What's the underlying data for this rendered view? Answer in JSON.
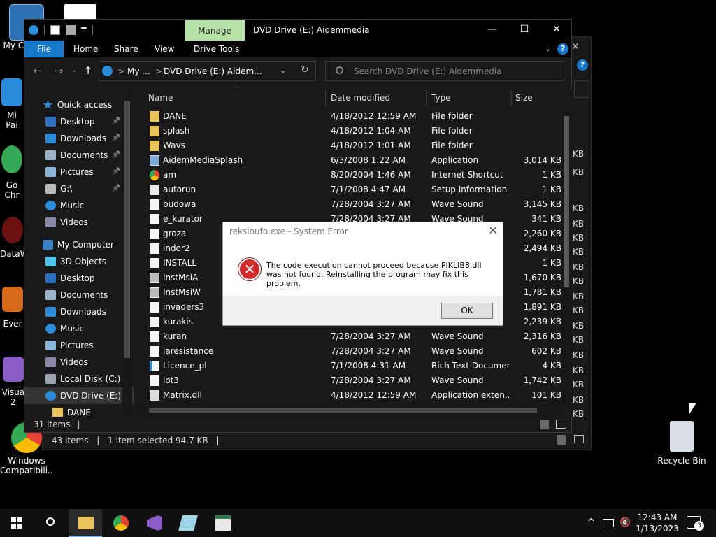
{
  "desktop": {
    "icons": [
      {
        "label": "My Co",
        "icon": "computer-icon"
      },
      {
        "label": "Mi\nPai",
        "icon": "paint-icon"
      },
      {
        "label": "Go\nChr",
        "icon": "chrome-icon"
      },
      {
        "label": "DataW",
        "icon": "datawiz-icon"
      },
      {
        "label": "Ever",
        "icon": "app-icon"
      },
      {
        "label": "Visua\n2",
        "icon": "visual-studio-icon"
      },
      {
        "label": "Windows\nCompatibili...",
        "icon": "chrome-icon"
      },
      {
        "label": "Recycle Bin",
        "icon": "recycle-bin-icon"
      }
    ]
  },
  "back_window": {
    "status_items": "43 items",
    "status_selected": "1 item selected  94.7 KB",
    "size_fragment": "KB"
  },
  "window": {
    "title": "DVD Drive (E:) Aidemmedia",
    "manage_tab": "Manage",
    "ribbon_tabs": [
      "File",
      "Home",
      "Share",
      "View",
      "Drive Tools"
    ],
    "help": "?",
    "address": {
      "part1": "My ...",
      "sep": ">",
      "part2": "DVD Drive (E:) Aidem..."
    },
    "search_placeholder": "Search DVD Drive (E:) Aidemmedia",
    "controls": {
      "minimize": "—",
      "maximize": "☐",
      "close": "✕"
    }
  },
  "navpane": [
    {
      "label": "Quick access",
      "icon": "star-icon",
      "pin": false,
      "indent": 0
    },
    {
      "label": "Desktop",
      "icon": "desktop-icon",
      "pin": true,
      "indent": 1
    },
    {
      "label": "Downloads",
      "icon": "downloads-icon",
      "pin": true,
      "indent": 1
    },
    {
      "label": "Documents",
      "icon": "documents-icon",
      "pin": true,
      "indent": 1
    },
    {
      "label": "Pictures",
      "icon": "pictures-icon",
      "pin": true,
      "indent": 1
    },
    {
      "label": "G:\\",
      "icon": "drive-icon",
      "pin": true,
      "indent": 1
    },
    {
      "label": "Music",
      "icon": "music-icon",
      "pin": false,
      "indent": 1
    },
    {
      "label": "Videos",
      "icon": "videos-icon",
      "pin": false,
      "indent": 1
    },
    {
      "label": "My Computer",
      "icon": "computer-icon",
      "pin": false,
      "indent": 0
    },
    {
      "label": "3D Objects",
      "icon": "3d-objects-icon",
      "pin": false,
      "indent": 1
    },
    {
      "label": "Desktop",
      "icon": "desktop-icon",
      "pin": false,
      "indent": 1
    },
    {
      "label": "Documents",
      "icon": "documents-icon",
      "pin": false,
      "indent": 1
    },
    {
      "label": "Downloads",
      "icon": "downloads-icon",
      "pin": false,
      "indent": 1
    },
    {
      "label": "Music",
      "icon": "music-icon",
      "pin": false,
      "indent": 1
    },
    {
      "label": "Pictures",
      "icon": "pictures-icon",
      "pin": false,
      "indent": 1
    },
    {
      "label": "Videos",
      "icon": "videos-icon",
      "pin": false,
      "indent": 1
    },
    {
      "label": "Local Disk (C:)",
      "icon": "local-disk-icon",
      "pin": false,
      "indent": 1
    },
    {
      "label": "DVD Drive (E:) Ai",
      "icon": "dvd-drive-icon",
      "pin": false,
      "indent": 1,
      "selected": true
    },
    {
      "label": "DANE",
      "icon": "folder-icon",
      "pin": false,
      "indent": 2
    }
  ],
  "columns": [
    "Name",
    "Date modified",
    "Type",
    "Size"
  ],
  "files": [
    {
      "name": "DANE",
      "date": "4/18/2012 12:59 AM",
      "type": "File folder",
      "size": "",
      "icon": "folder-icon"
    },
    {
      "name": "splash",
      "date": "4/18/2012 1:04 AM",
      "type": "File folder",
      "size": "",
      "icon": "folder-icon"
    },
    {
      "name": "Wavs",
      "date": "4/18/2012 1:01 AM",
      "type": "File folder",
      "size": "",
      "icon": "folder-icon"
    },
    {
      "name": "AidemMediaSplash",
      "date": "6/3/2008 1:22 AM",
      "type": "Application",
      "size": "3,014 KB",
      "icon": "application-icon"
    },
    {
      "name": "am",
      "date": "8/20/2004 1:46 AM",
      "type": "Internet Shortcut",
      "size": "1 KB",
      "icon": "chrome-icon"
    },
    {
      "name": "autorun",
      "date": "7/1/2008 4:47 AM",
      "type": "Setup Information",
      "size": "1 KB",
      "icon": "setup-icon"
    },
    {
      "name": "budowa",
      "date": "7/28/2004 3:27 AM",
      "type": "Wave Sound",
      "size": "3,145 KB",
      "icon": "wave-icon"
    },
    {
      "name": "e_kurator",
      "date": "7/28/2004 3:27 AM",
      "type": "Wave Sound",
      "size": "341 KB",
      "icon": "wave-icon"
    },
    {
      "name": "groza",
      "date": "",
      "type": "",
      "size": "2,260 KB",
      "icon": "wave-icon"
    },
    {
      "name": "indor2",
      "date": "",
      "type": "",
      "size": "2,494 KB",
      "icon": "wave-icon"
    },
    {
      "name": "INSTALL",
      "date": "",
      "type": "",
      "size": "1 KB",
      "icon": "text-file-icon"
    },
    {
      "name": "InstMsiA",
      "date": "",
      "type": "",
      "size": "1,670 KB",
      "icon": "installer-icon"
    },
    {
      "name": "InstMsiW",
      "date": "",
      "type": "",
      "size": "1,781 KB",
      "icon": "installer-icon"
    },
    {
      "name": "invaders3",
      "date": "",
      "type": "",
      "size": "1,891 KB",
      "icon": "wave-icon"
    },
    {
      "name": "kurakis",
      "date": "",
      "type": "",
      "size": "2,239 KB",
      "icon": "wave-icon"
    },
    {
      "name": "kuran",
      "date": "7/28/2004 3:27 AM",
      "type": "Wave Sound",
      "size": "2,316 KB",
      "icon": "wave-icon"
    },
    {
      "name": "laresistance",
      "date": "7/28/2004 3:27 AM",
      "type": "Wave Sound",
      "size": "602 KB",
      "icon": "wave-icon"
    },
    {
      "name": "Licence_pl",
      "date": "7/1/2008 4:31 AM",
      "type": "Rich Text Document",
      "size": "4 KB",
      "icon": "rtf-icon"
    },
    {
      "name": "lot3",
      "date": "7/28/2004 3:27 AM",
      "type": "Wave Sound",
      "size": "1,742 KB",
      "icon": "wave-icon"
    },
    {
      "name": "Matrix.dll",
      "date": "4/18/2012 12:59 AM",
      "type": "Application exten...",
      "size": "101 KB",
      "icon": "dll-icon"
    }
  ],
  "status": {
    "items": "31 items",
    "sep": "|"
  },
  "dialog": {
    "title": "reksioufo.exe - System Error",
    "close": "✕",
    "message": "The code execution cannot proceed because PIKLIB8.dll was not found. Reinstalling the program may fix this problem.",
    "ok": "OK",
    "error_glyph": "✕"
  },
  "taskbar": {
    "time": "12:43 AM",
    "date": "1/13/2023",
    "notifications": "3",
    "apps": [
      "start-icon",
      "search-icon",
      "file-explorer-icon",
      "chrome-icon",
      "visual-studio-icon",
      "notepad-icon",
      "app-window-icon"
    ]
  },
  "colors": {
    "accent": "#1979ca",
    "manage": "#b6e2a7",
    "folder": "#e8c25a",
    "error": "#d22a2a"
  }
}
